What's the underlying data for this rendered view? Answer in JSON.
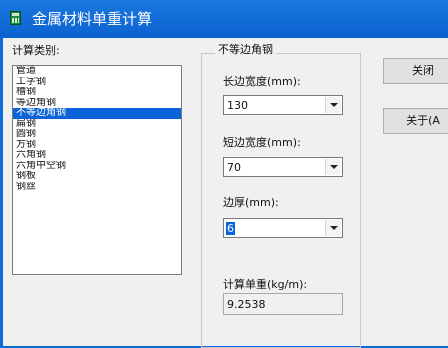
{
  "window": {
    "title": "金属材料单重计算",
    "icon": "calculator-icon"
  },
  "category": {
    "label": "计算类别:",
    "items": [
      "管道",
      "工字钢",
      "槽钢",
      "等边角钢",
      "不等边角钢",
      "扁钢",
      "圆钢",
      "方钢",
      "六角钢",
      "六角中空钢",
      "钢板",
      "钢丝"
    ],
    "selected": "不等边角钢"
  },
  "params": {
    "group_title": "不等边角钢",
    "long_width_label": "长边宽度(mm):",
    "long_width_value": "130",
    "short_width_label": "短边宽度(mm):",
    "short_width_value": "70",
    "thickness_label": "边厚(mm):",
    "thickness_value": "6",
    "result_label": "计算单重(kg/m):",
    "result_value": "9.2538"
  },
  "buttons": {
    "close_label": "关闭",
    "about_label": "关于(A"
  }
}
